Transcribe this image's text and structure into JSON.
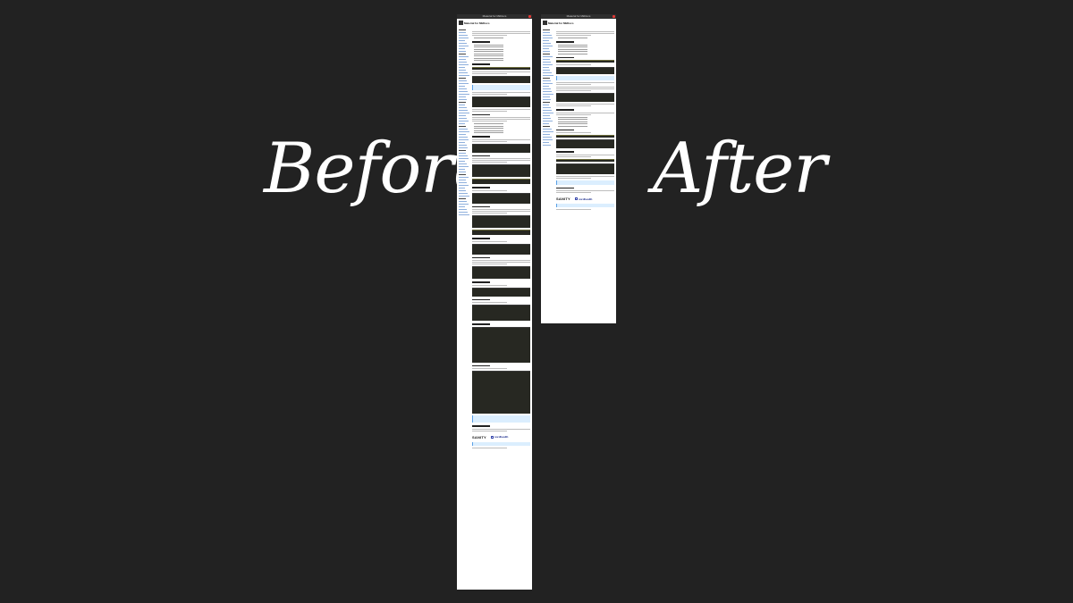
{
  "labels": {
    "before": "Before",
    "after": "After"
  },
  "screens": [
    {
      "id": "before",
      "title_bar": "Material for MkDocs",
      "brand": "Material for MkDocs",
      "sponsors": [
        "SANITY",
        "nordhealth"
      ]
    },
    {
      "id": "after",
      "title_bar": "Material for MkDocs",
      "brand": "Material for MkDocs",
      "sponsors": [
        "SANITY",
        "nordhealth"
      ]
    }
  ],
  "colors": {
    "background": "#222222",
    "label": "#ffffff",
    "code_block": "#272822",
    "note": "#dbeefe",
    "link": "#3b6fb6",
    "close_button": "#e53935"
  }
}
